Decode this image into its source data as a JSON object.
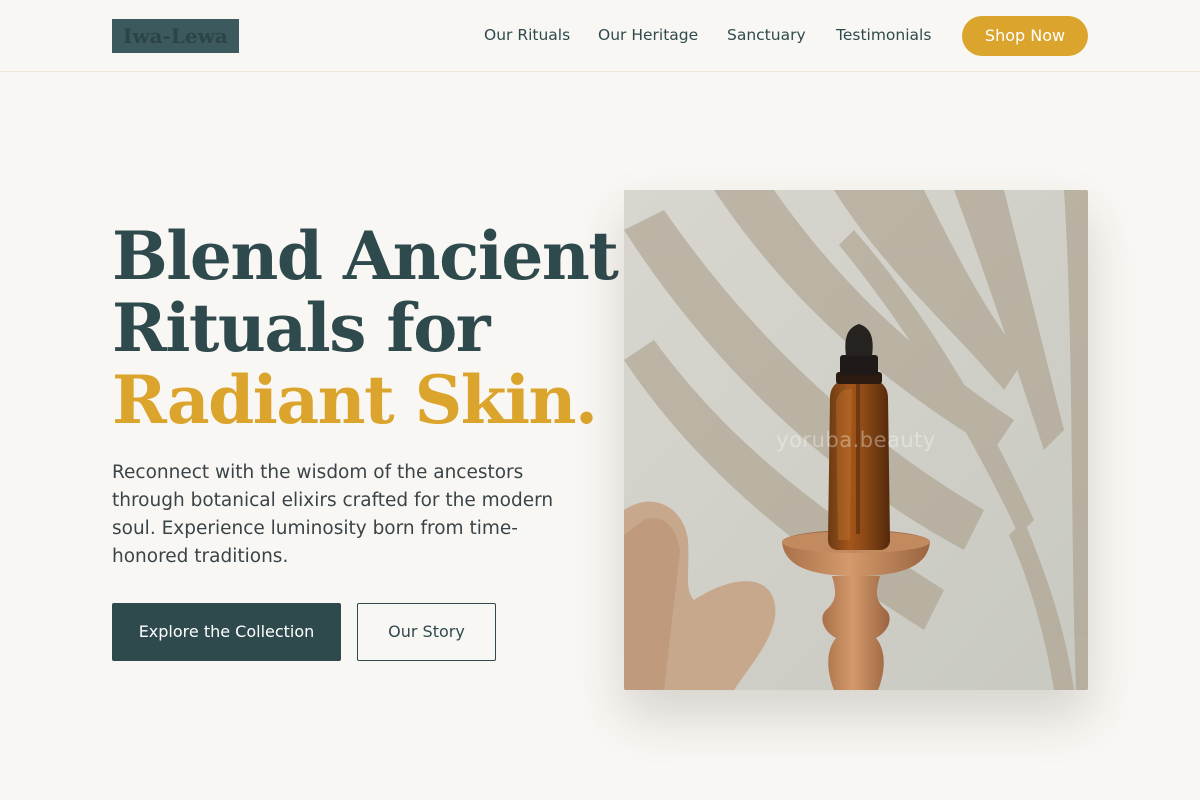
{
  "brand": {
    "name": "Iwa-Lewa"
  },
  "nav": {
    "items": [
      {
        "label": "Our Rituals"
      },
      {
        "label": "Our Heritage"
      },
      {
        "label": "Sanctuary"
      },
      {
        "label": "Testimonials"
      }
    ],
    "cta_label": "Shop Now"
  },
  "hero": {
    "headline_line1": "Blend Ancient",
    "headline_line2": "Rituals for",
    "headline_accent": "Radiant Skin.",
    "description": "Reconnect with the wisdom of the ancestors through botanical elixirs crafted for the modern soul. Experience luminosity born from time-honored traditions.",
    "primary_button": "Explore the Collection",
    "secondary_button": "Our Story",
    "image_watermark": "yoruba.beauty"
  },
  "colors": {
    "background": "#f9f7f3",
    "primary": "#2f4a4d",
    "accent": "#dba42c"
  }
}
